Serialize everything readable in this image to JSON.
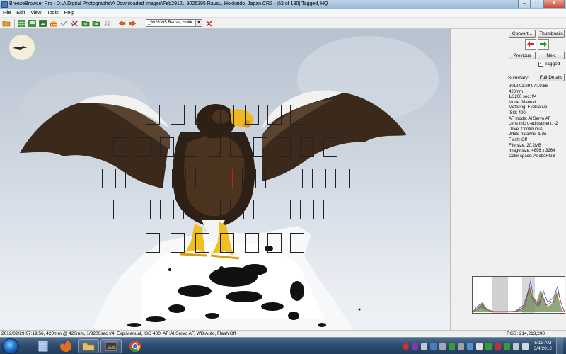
{
  "window": {
    "title": "BreezeBrowser Pro - D:\\A Digital Photographs\\A Downloaded Images\\Feb2912\\_9026395  Rausu, Hokkaido, Japan.CR2 - [62 of 180] Tagged, HQ",
    "minimize_label": "–",
    "maximize_label": "□",
    "close_label": "✕"
  },
  "menu": {
    "items": [
      {
        "label": "File"
      },
      {
        "label": "Edit"
      },
      {
        "label": "View"
      },
      {
        "label": "Tools"
      },
      {
        "label": "Help"
      }
    ]
  },
  "toolbar": {
    "buttons": [
      {
        "icon": "open-folder-icon",
        "color": "#e0a020"
      },
      {
        "icon": "thumbnails-grid-icon",
        "color": "#2a8a2a"
      },
      {
        "icon": "filmstrip-icon",
        "color": "#2a8a2a"
      },
      {
        "icon": "single-image-icon",
        "color": "#2a8a2a"
      },
      {
        "icon": "raw-icon",
        "color": "#e06a10"
      },
      {
        "icon": "check-icon",
        "color": "#7a7a7a"
      },
      {
        "icon": "crossed-check-icon",
        "color": "#c02020"
      },
      {
        "icon": "tag-folder-icon",
        "color": "#2a8a2a"
      },
      {
        "icon": "untag-folder-icon",
        "color": "#2a8a2a"
      },
      {
        "icon": "music-note-icon",
        "color": "#808080"
      },
      {
        "icon": "prev-arrow-icon",
        "color": "#e06010"
      },
      {
        "icon": "next-arrow-icon",
        "color": "#e06010"
      }
    ],
    "file_select": "_9026395  Rausu, Hokk",
    "clear_icon_color": "#c02020"
  },
  "panel": {
    "convert_label": "Convert...",
    "thumbnails_label": "Thumbnails",
    "previous_label": "Previous",
    "next_label": "Next",
    "tagged_label": "Tagged",
    "tagged_checked": true,
    "summary_label": "Summary:",
    "full_details_label": "Full Details",
    "details": [
      "2012:02:29 07:19:56",
      "420mm",
      "1/3200 sec; f/4",
      "Mode: Manual",
      "Metering: Evaluative",
      "ISO: 400",
      "AF mode: AI Servo AF",
      "Lens micro-adjustment: -2",
      "Drive: Continuous",
      "White balance: Auto",
      "Flash: Off",
      "File size: 20.2MB",
      "Image size: 4896 x 3264",
      "Color space: AdobeRGB"
    ]
  },
  "status": {
    "left": "2012/02/29 07:19:56, 420mm @ 420mm, 1/3200sec f/4, Exp:Manual, ISO 400, AF:AI Servo AF, WB:Auto, Flash:Off",
    "right": "RGB: 214,213,200"
  },
  "taskbar": {
    "apps": [
      {
        "icon": "notepad-icon",
        "color": "#9ab8e0"
      },
      {
        "icon": "firefox-icon",
        "color": "#e0701a"
      },
      {
        "icon": "explorer-folder-icon",
        "color": "#e8c060"
      },
      {
        "icon": "breezebrowser-icon",
        "color": "#6a4a2a"
      },
      {
        "icon": "chrome-icon",
        "color": "#d04a3a"
      }
    ],
    "tray_icons": [
      {
        "icon": "red-alert-icon",
        "color": "#d03030"
      },
      {
        "icon": "purple-app-icon",
        "color": "#7a3ab0"
      },
      {
        "icon": "tray-app-icon",
        "color": "#c0c8d0"
      },
      {
        "icon": "tray-app-icon",
        "color": "#4a7ac0"
      },
      {
        "icon": "tray-app-icon",
        "color": "#a0a8b0"
      },
      {
        "icon": "tray-app-icon",
        "color": "#3a9a3a"
      },
      {
        "icon": "tray-app-icon",
        "color": "#a0a0a0"
      },
      {
        "icon": "tray-app-icon",
        "color": "#5a8ad0"
      },
      {
        "icon": "tray-app-icon",
        "color": "#e0e0e0"
      },
      {
        "icon": "tray-app-icon",
        "color": "#3a9a3a"
      },
      {
        "icon": "tray-app-icon",
        "color": "#c03030"
      },
      {
        "icon": "tray-app-icon",
        "color": "#3a9a3a"
      },
      {
        "icon": "tray-app-icon",
        "color": "#c0c8d0"
      },
      {
        "icon": "volume-icon",
        "color": "#d0d8e0"
      }
    ],
    "clock_time": "5:13 AM",
    "clock_date": "3/4/2012"
  }
}
